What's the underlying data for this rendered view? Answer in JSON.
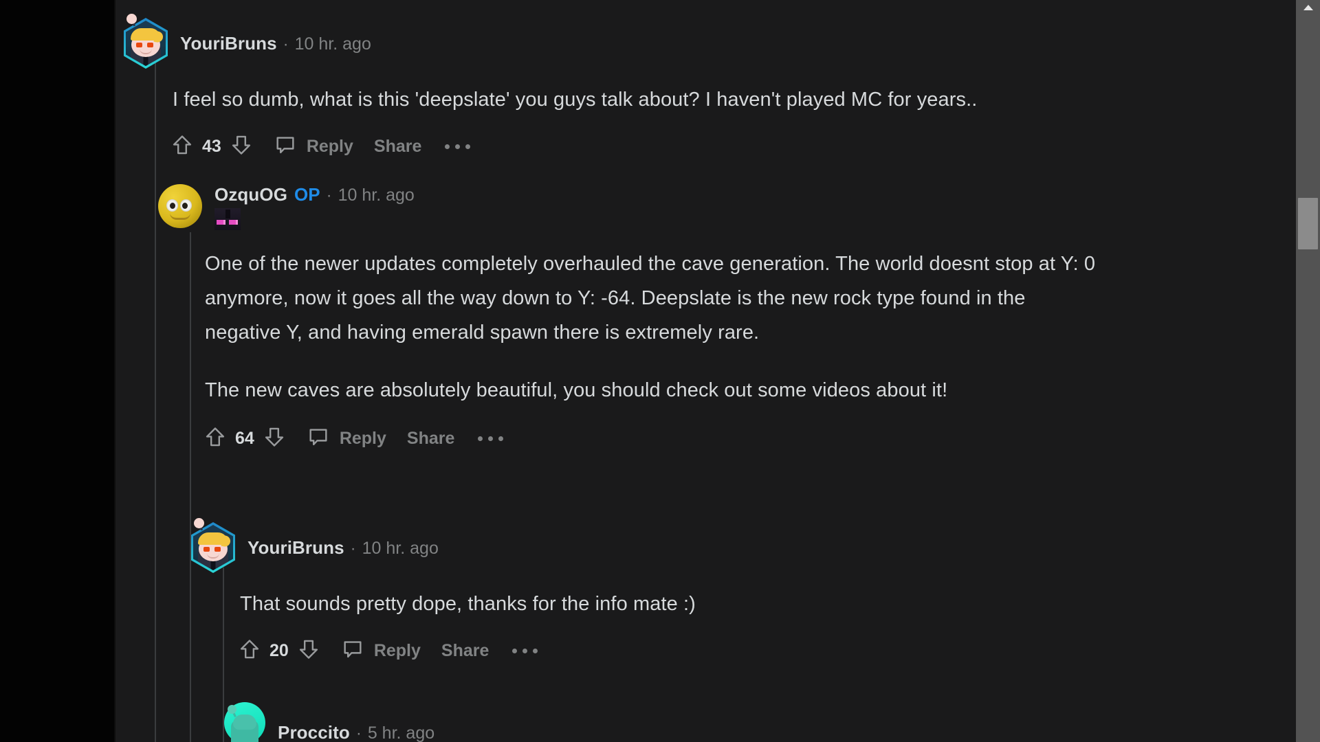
{
  "theme": {
    "page_background": "#030303",
    "content_background": "#1a1a1b",
    "body_text_color": "#d7dadc",
    "muted_text_color": "#818384",
    "op_badge_color": "#1f8ce8",
    "thread_line_color": "#3a3c3e",
    "scrollbar_track": "#535353",
    "scrollbar_thumb": "#8b8b8b"
  },
  "action_labels": {
    "reply": "Reply",
    "share": "Share",
    "more": "•••"
  },
  "icons": {
    "upvote": "upvote-arrow-icon",
    "downvote": "downvote-arrow-icon",
    "comment": "comment-bubble-icon",
    "more": "more-options-icon",
    "scroll_up": "scroll-up-arrow-icon"
  },
  "comments": [
    {
      "id": "c1",
      "username": "YouriBruns",
      "op": false,
      "separator": "·",
      "timestamp": "10 hr. ago",
      "avatar": "snoo-blonde-hex-avatar",
      "flair": null,
      "paragraphs": [
        "I feel so dumb, what is this 'deepslate' you guys talk about? I haven't played MC for years.."
      ],
      "score": "43",
      "reply": "Reply",
      "share": "Share"
    },
    {
      "id": "c2",
      "username": "OzquOG",
      "op": true,
      "op_label": "OP",
      "separator": "·",
      "timestamp": "10 hr. ago",
      "avatar": "yellow-emoji-avatar",
      "flair": "enderman-face-flair",
      "paragraphs": [
        "One of the newer updates completely overhauled the cave generation. The world doesnt stop at Y: 0 anymore, now it goes all the way down to Y: -64. Deepslate is the new rock type found in the negative Y, and having emerald spawn there is extremely rare.",
        "The new caves are absolutely beautiful, you should check out some videos about it!"
      ],
      "score": "64",
      "reply": "Reply",
      "share": "Share"
    },
    {
      "id": "c3",
      "username": "YouriBruns",
      "op": false,
      "separator": "·",
      "timestamp": "10 hr. ago",
      "avatar": "snoo-blonde-hex-avatar",
      "flair": null,
      "paragraphs": [
        "That sounds pretty dope, thanks for the info mate :)"
      ],
      "score": "20",
      "reply": "Reply",
      "share": "Share"
    },
    {
      "id": "c4",
      "username": "Proccito",
      "op": false,
      "separator": "·",
      "timestamp": "5 hr. ago",
      "avatar": "snoo-teal-circle-avatar",
      "flair": null,
      "paragraphs": [],
      "score": null,
      "reply": null,
      "share": null
    }
  ]
}
